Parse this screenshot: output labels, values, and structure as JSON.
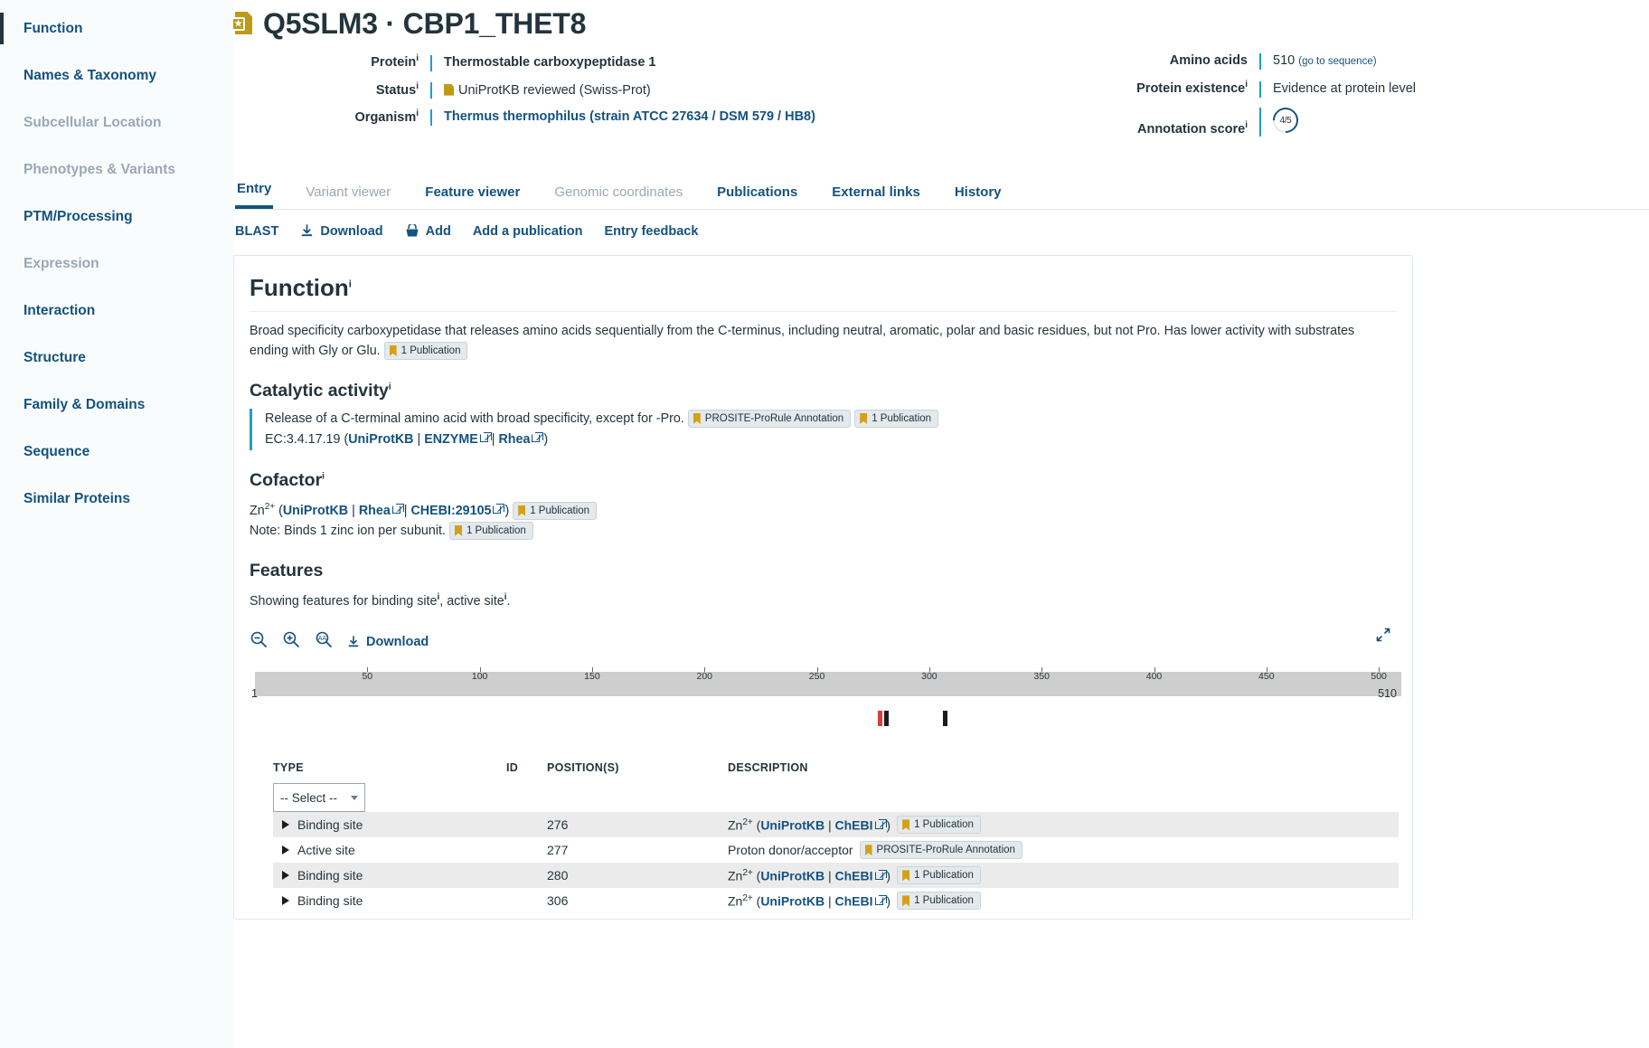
{
  "sidebar": {
    "items": [
      {
        "label": "Function",
        "state": "active"
      },
      {
        "label": "Names & Taxonomy",
        "state": "enabled"
      },
      {
        "label": "Subcellular Location",
        "state": "disabled"
      },
      {
        "label": "Phenotypes & Variants",
        "state": "disabled"
      },
      {
        "label": "PTM/Processing",
        "state": "enabled"
      },
      {
        "label": "Expression",
        "state": "disabled"
      },
      {
        "label": "Interaction",
        "state": "enabled"
      },
      {
        "label": "Structure",
        "state": "enabled"
      },
      {
        "label": "Family & Domains",
        "state": "enabled"
      },
      {
        "label": "Sequence",
        "state": "enabled"
      },
      {
        "label": "Similar Proteins",
        "state": "enabled"
      }
    ]
  },
  "header": {
    "accession": "Q5SLM3",
    "separator": "·",
    "entry_name": "CBP1_THET8",
    "title": "Q5SLM3 · CBP1_THET8",
    "icon": "swissprot-reviewed-icon",
    "left_fields": [
      {
        "label": "Protein",
        "info": true,
        "value": "Thermostable carboxypeptidase 1",
        "style": "bold"
      },
      {
        "label": "Status",
        "info": true,
        "value": "UniProtKB reviewed (Swiss-Prot)",
        "style": "plain",
        "icon": "swissprot-mini-icon"
      },
      {
        "label": "Organism",
        "info": true,
        "value": "Thermus thermophilus (strain ATCC 27634 / DSM 579 / HB8)",
        "style": "link"
      }
    ],
    "right_fields": [
      {
        "label": "Amino acids",
        "info": false,
        "value": "510",
        "suffix": "(go to sequence)"
      },
      {
        "label": "Protein existence",
        "info": true,
        "value": "Evidence at protein level"
      },
      {
        "label": "Annotation score",
        "info": true,
        "value": "4/5",
        "badge": "annotation-score-ring"
      }
    ]
  },
  "tabs": [
    {
      "label": "Entry",
      "state": "active"
    },
    {
      "label": "Variant viewer",
      "state": "disabled"
    },
    {
      "label": "Feature viewer",
      "state": "enabled"
    },
    {
      "label": "Genomic coordinates",
      "state": "disabled"
    },
    {
      "label": "Publications",
      "state": "enabled"
    },
    {
      "label": "External links",
      "state": "enabled"
    },
    {
      "label": "History",
      "state": "enabled"
    }
  ],
  "toolbar": [
    {
      "label": "BLAST",
      "icon": null
    },
    {
      "label": "Download",
      "icon": "download-icon"
    },
    {
      "label": "Add",
      "icon": "basket-icon"
    },
    {
      "label": "Add a publication",
      "icon": null
    },
    {
      "label": "Entry feedback",
      "icon": null
    }
  ],
  "function_section": {
    "title": "Function",
    "description": "Broad specificity carboxypetidase that releases amino acids sequentially from the C-terminus, including neutral, aromatic, polar and basic residues, but not Pro. Has lower activity with substrates ending with Gly or Glu.",
    "description_badge": "1 Publication",
    "catalytic": {
      "title": "Catalytic activity",
      "reaction": "Release of a C-terminal amino acid with broad specificity, except for -Pro.",
      "badges": [
        "PROSITE-ProRule Annotation",
        "1 Publication"
      ],
      "ec_prefix": "EC:3.4.17.19",
      "ec_open": "(",
      "ec_links": [
        "UniProtKB",
        "ENZYME",
        "Rhea"
      ],
      "ec_sep": "|",
      "ec_close": ")"
    },
    "cofactor": {
      "title": "Cofactor",
      "ion": "Zn",
      "charge": "2+",
      "open": "(",
      "links": [
        "UniProtKB",
        "Rhea",
        "CHEBI:29105"
      ],
      "sep": "|",
      "close": ")",
      "badge": "1 Publication",
      "note": "Note: Binds 1 zinc ion per subunit.",
      "note_badge": "1 Publication"
    },
    "features": {
      "title": "Features",
      "subtitle_prefix": "Showing features for ",
      "subtitle_a": "binding site",
      "subtitle_mid": ", ",
      "subtitle_b": "active site",
      "subtitle_suffix": "."
    }
  },
  "feature_viewer": {
    "tools": [
      {
        "name": "zoom-out-icon",
        "label": ""
      },
      {
        "name": "zoom-in-icon",
        "label": ""
      },
      {
        "name": "zoom-to-sequence-icon",
        "label": ""
      },
      {
        "name": "download-icon",
        "label": "Download"
      }
    ],
    "expand_icon": "expand-icon",
    "ruler": {
      "start": "1",
      "end": "510",
      "ticks": [
        50,
        100,
        150,
        200,
        250,
        300,
        350,
        400,
        450,
        500
      ],
      "length": 510
    },
    "markers": [
      {
        "position": 277,
        "color": "#e03a3a",
        "name": "active-site-marker"
      },
      {
        "position": 280,
        "color": "#1c1c1c",
        "name": "binding-site-marker"
      },
      {
        "position": 306,
        "color": "#1c1c1c",
        "name": "binding-site-marker"
      }
    ]
  },
  "feature_table": {
    "columns": [
      "TYPE",
      "ID",
      "POSITION(S)",
      "DESCRIPTION"
    ],
    "type_filter": {
      "value": "-- Select --"
    },
    "rows": [
      {
        "type": "Binding site",
        "id": "",
        "position": "276",
        "desc_ion": "Zn",
        "desc_charge": "2+",
        "desc_open": "(",
        "desc_links": [
          "UniProtKB",
          "ChEBI"
        ],
        "desc_sep": "|",
        "desc_close": ")",
        "desc_text": "",
        "badge": "1 Publication"
      },
      {
        "type": "Active site",
        "id": "",
        "position": "277",
        "desc_ion": "",
        "desc_charge": "",
        "desc_open": "",
        "desc_links": [],
        "desc_sep": "",
        "desc_close": "",
        "desc_text": "Proton donor/acceptor",
        "badge": "PROSITE-ProRule Annotation"
      },
      {
        "type": "Binding site",
        "id": "",
        "position": "280",
        "desc_ion": "Zn",
        "desc_charge": "2+",
        "desc_open": "(",
        "desc_links": [
          "UniProtKB",
          "ChEBI"
        ],
        "desc_sep": "|",
        "desc_close": ")",
        "desc_text": "",
        "badge": "1 Publication"
      },
      {
        "type": "Binding site",
        "id": "",
        "position": "306",
        "desc_ion": "Zn",
        "desc_charge": "2+",
        "desc_open": "(",
        "desc_links": [
          "UniProtKB",
          "ChEBI"
        ],
        "desc_sep": "|",
        "desc_close": ")",
        "desc_text": "",
        "badge": "1 Publication"
      }
    ]
  },
  "colors": {
    "link": "#14527f",
    "accent_bar": "#1e9dd4",
    "gold": "#bd9b16",
    "flag": "#d4a017",
    "ruler": "#cecece",
    "row_alt": "#ebebeb",
    "marker_red": "#e03a3a",
    "marker_dark": "#1c1c1c"
  }
}
